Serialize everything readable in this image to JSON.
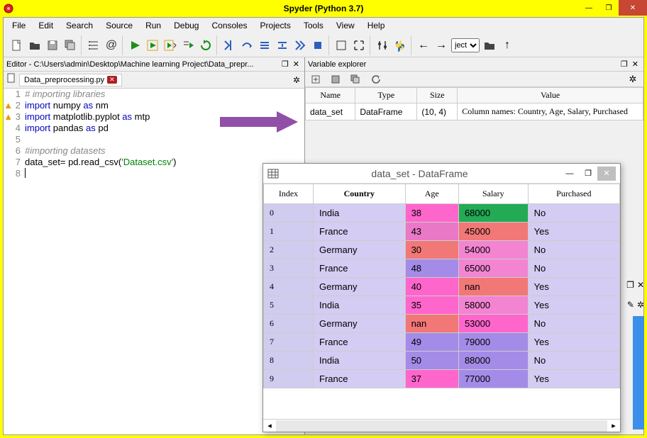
{
  "window": {
    "title": "Spyder (Python 3.7)"
  },
  "menu": [
    "File",
    "Edit",
    "Search",
    "Source",
    "Run",
    "Debug",
    "Consoles",
    "Projects",
    "Tools",
    "View",
    "Help"
  ],
  "toolbar": {
    "select_value": "ject"
  },
  "editor_pane": {
    "breadcrumb": "Editor - C:\\Users\\admin\\Desktop\\Machine learning Project\\Data_prepr...",
    "tab_name": "Data_preprocessing.py",
    "code": {
      "l1": "# importing libraries",
      "l2a": "import",
      "l2b": " numpy ",
      "l2c": "as",
      "l2d": " nm",
      "l3a": "import",
      "l3b": " matplotlib.pyplot ",
      "l3c": "as",
      "l3d": " mtp",
      "l4a": "import",
      "l4b": " pandas ",
      "l4c": "as",
      "l4d": " pd",
      "l6": "#importing datasets",
      "l7a": "data_set= pd.read_csv(",
      "l7b": "'Dataset.csv'",
      "l7c": ")"
    }
  },
  "variable_explorer": {
    "title": "Variable explorer",
    "headers": [
      "Name",
      "Type",
      "Size",
      "Value"
    ],
    "row": {
      "name": "data_set",
      "type": "DataFrame",
      "size": "(10, 4)",
      "value": "Column names: Country, Age, Salary, Purchased"
    }
  },
  "dataframe_window": {
    "title": "data_set - DataFrame",
    "headers": [
      "Index",
      "Country",
      "Age",
      "Salary",
      "Purchased"
    ],
    "bold_header_index": 1,
    "rows": [
      {
        "idx": "0",
        "cells": [
          {
            "v": "India",
            "bg": "#d4ccf2"
          },
          {
            "v": "38",
            "bg": "#ff66cc"
          },
          {
            "v": "68000",
            "bg": "#22aa55"
          },
          {
            "v": "No",
            "bg": "#d4ccf2"
          }
        ]
      },
      {
        "idx": "1",
        "cells": [
          {
            "v": "France",
            "bg": "#d4ccf2"
          },
          {
            "v": "43",
            "bg": "#e978c6"
          },
          {
            "v": "45000",
            "bg": "#f27777"
          },
          {
            "v": "Yes",
            "bg": "#d4ccf2"
          }
        ]
      },
      {
        "idx": "2",
        "cells": [
          {
            "v": "Germany",
            "bg": "#d4ccf2"
          },
          {
            "v": "30",
            "bg": "#f27777"
          },
          {
            "v": "54000",
            "bg": "#f384d2"
          },
          {
            "v": "No",
            "bg": "#d4ccf2"
          }
        ]
      },
      {
        "idx": "3",
        "cells": [
          {
            "v": "France",
            "bg": "#d4ccf2"
          },
          {
            "v": "48",
            "bg": "#a48be8"
          },
          {
            "v": "65000",
            "bg": "#f384d2"
          },
          {
            "v": "No",
            "bg": "#d4ccf2"
          }
        ]
      },
      {
        "idx": "4",
        "cells": [
          {
            "v": "Germany",
            "bg": "#d4ccf2"
          },
          {
            "v": "40",
            "bg": "#ff66cc"
          },
          {
            "v": "nan",
            "bg": "#f27777"
          },
          {
            "v": "Yes",
            "bg": "#d4ccf2"
          }
        ]
      },
      {
        "idx": "5",
        "cells": [
          {
            "v": "India",
            "bg": "#d4ccf2"
          },
          {
            "v": "35",
            "bg": "#ff66cc"
          },
          {
            "v": "58000",
            "bg": "#f384d2"
          },
          {
            "v": "Yes",
            "bg": "#d4ccf2"
          }
        ]
      },
      {
        "idx": "6",
        "cells": [
          {
            "v": "Germany",
            "bg": "#d4ccf2"
          },
          {
            "v": "nan",
            "bg": "#f27777"
          },
          {
            "v": "53000",
            "bg": "#ff66cc"
          },
          {
            "v": "No",
            "bg": "#d4ccf2"
          }
        ]
      },
      {
        "idx": "7",
        "cells": [
          {
            "v": "France",
            "bg": "#d4ccf2"
          },
          {
            "v": "49",
            "bg": "#a48be8"
          },
          {
            "v": "79000",
            "bg": "#a48be8"
          },
          {
            "v": "Yes",
            "bg": "#d4ccf2"
          }
        ]
      },
      {
        "idx": "8",
        "cells": [
          {
            "v": "India",
            "bg": "#d4ccf2"
          },
          {
            "v": "50",
            "bg": "#a48be8"
          },
          {
            "v": "88000",
            "bg": "#a48be8"
          },
          {
            "v": "No",
            "bg": "#d4ccf2"
          }
        ]
      },
      {
        "idx": "9",
        "cells": [
          {
            "v": "France",
            "bg": "#d4ccf2"
          },
          {
            "v": "37",
            "bg": "#ff66cc"
          },
          {
            "v": "77000",
            "bg": "#a48be8"
          },
          {
            "v": "Yes",
            "bg": "#d4ccf2"
          }
        ]
      }
    ]
  }
}
